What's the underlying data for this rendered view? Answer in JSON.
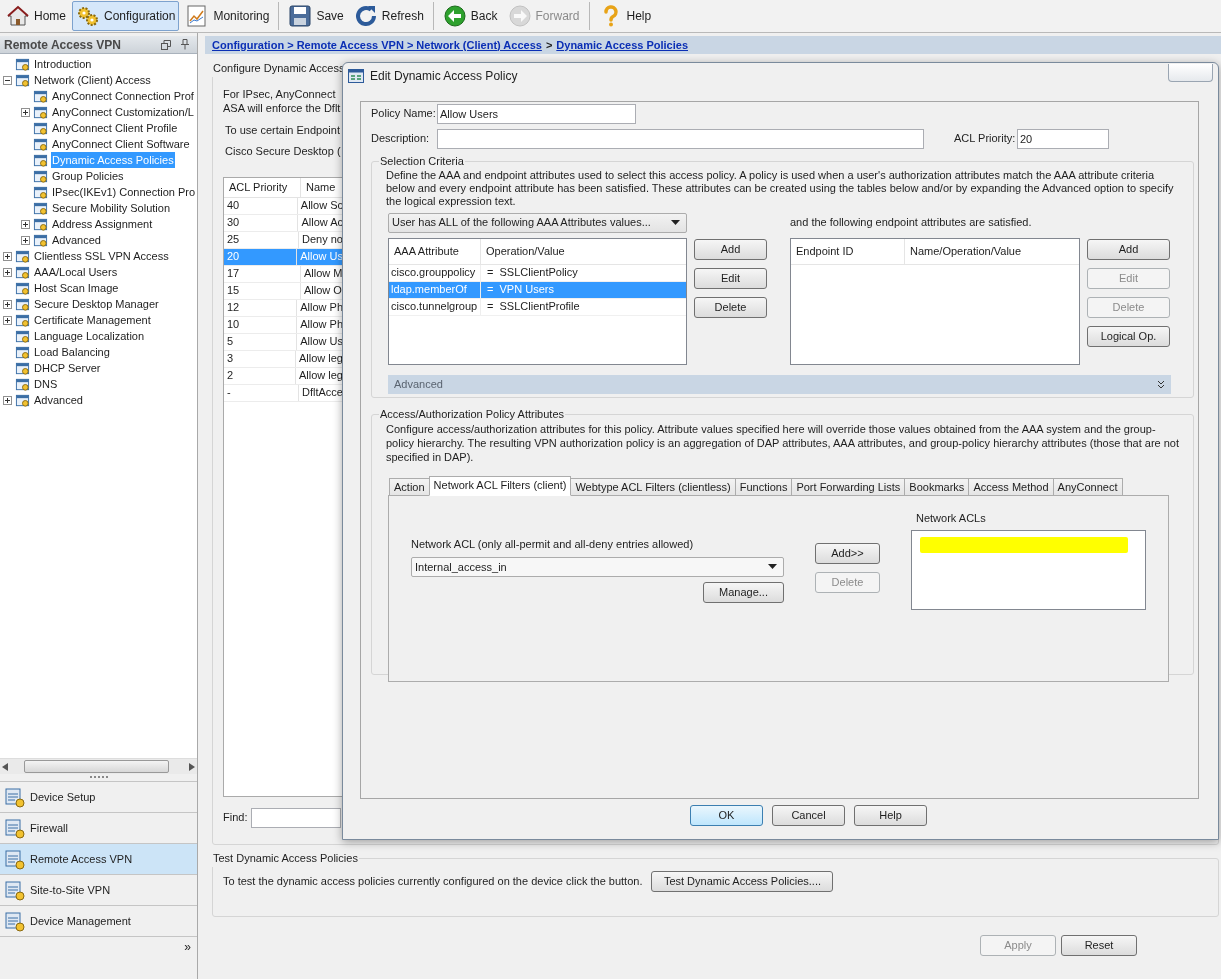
{
  "toolbar": {
    "groups": [
      [
        {
          "label": "Home",
          "selected": false,
          "disabled": false
        },
        {
          "label": "Configuration",
          "selected": true,
          "disabled": false
        },
        {
          "label": "Monitoring",
          "selected": false,
          "disabled": false
        }
      ],
      [
        {
          "label": "Save",
          "selected": false,
          "disabled": false
        },
        {
          "label": "Refresh",
          "selected": false,
          "disabled": false
        }
      ],
      [
        {
          "label": "Back",
          "selected": false,
          "disabled": false
        },
        {
          "label": "Forward",
          "selected": false,
          "disabled": true
        }
      ],
      [
        {
          "label": "Help",
          "selected": false,
          "disabled": false
        }
      ]
    ]
  },
  "sidebar": {
    "title": "Remote Access VPN",
    "tree": [
      {
        "label": "Introduction",
        "selected": false
      },
      {
        "label": "Network (Client) Access",
        "selected": false,
        "expanded": true,
        "children": [
          {
            "label": "AnyConnect Connection Prof",
            "selected": false
          },
          {
            "label": "AnyConnect Customization/L",
            "selected": false,
            "expanded": false
          },
          {
            "label": "AnyConnect Client Profile",
            "selected": false
          },
          {
            "label": "AnyConnect Client Software",
            "selected": false
          },
          {
            "label": "Dynamic Access Policies",
            "selected": true
          },
          {
            "label": "Group Policies",
            "selected": false
          },
          {
            "label": "IPsec(IKEv1) Connection Pro",
            "selected": false
          },
          {
            "label": "Secure Mobility Solution",
            "selected": false
          },
          {
            "label": "Address Assignment",
            "selected": false,
            "expanded": false
          },
          {
            "label": "Advanced",
            "selected": false,
            "expanded": false
          }
        ]
      },
      {
        "label": "Clientless SSL VPN Access",
        "selected": false,
        "expanded": false
      },
      {
        "label": "AAA/Local Users",
        "selected": false,
        "expanded": false
      },
      {
        "label": "Host Scan Image",
        "selected": false
      },
      {
        "label": "Secure Desktop Manager",
        "selected": false,
        "expanded": false
      },
      {
        "label": "Certificate Management",
        "selected": false,
        "expanded": false
      },
      {
        "label": "Language Localization",
        "selected": false
      },
      {
        "label": "Load Balancing",
        "selected": false
      },
      {
        "label": "DHCP Server",
        "selected": false
      },
      {
        "label": "DNS",
        "selected": false
      },
      {
        "label": "Advanced",
        "selected": false,
        "expanded": false
      }
    ],
    "nav": [
      {
        "label": "Device Setup",
        "selected": false
      },
      {
        "label": "Firewall",
        "selected": false
      },
      {
        "label": "Remote Access VPN",
        "selected": true
      },
      {
        "label": "Site-to-Site VPN",
        "selected": false
      },
      {
        "label": "Device Management",
        "selected": false
      }
    ],
    "more": "»"
  },
  "breadcrumb": [
    {
      "text": "Configuration > Remote Access VPN > Network (Client) Access",
      "link": true
    },
    {
      "text": ">",
      "link": false
    },
    {
      "text": "Dynamic Access Policies",
      "link": true
    }
  ],
  "main": {
    "legend": "Configure Dynamic Access",
    "lines": [
      "For IPsec, AnyConnect",
      "ASA will enforce the Dflt",
      "To use certain Endpoint",
      "Cisco Secure Desktop ("
    ],
    "table": {
      "columns": [
        "ACL Priority",
        "Name"
      ],
      "rows": [
        {
          "cells": [
            "40",
            "Allow Sc"
          ],
          "selected": false
        },
        {
          "cells": [
            "30",
            "Allow Ac"
          ],
          "selected": false
        },
        {
          "cells": [
            "25",
            "Deny no"
          ],
          "selected": false
        },
        {
          "cells": [
            "20",
            "Allow Us"
          ],
          "selected": true
        },
        {
          "cells": [
            "17",
            "Allow M"
          ],
          "selected": false
        },
        {
          "cells": [
            "15",
            "Allow O"
          ],
          "selected": false
        },
        {
          "cells": [
            "12",
            "Allow Ph"
          ],
          "selected": false
        },
        {
          "cells": [
            "10",
            "Allow Ph"
          ],
          "selected": false
        },
        {
          "cells": [
            "5",
            "Allow Us"
          ],
          "selected": false
        },
        {
          "cells": [
            "3",
            "Allow leg"
          ],
          "selected": false
        },
        {
          "cells": [
            "2",
            "Allow leg"
          ],
          "selected": false
        },
        {
          "cells": [
            "-",
            "DfltAcce"
          ],
          "selected": false
        }
      ]
    },
    "find_label": "Find:",
    "test_group": {
      "legend": "Test Dynamic Access Policies",
      "text": "To test the dynamic access policies currently configured on the device click the button.",
      "button": "Test Dynamic Access Policies...."
    },
    "buttons": [
      {
        "label": "Apply",
        "disabled": true
      },
      {
        "label": "Reset",
        "disabled": false
      }
    ]
  },
  "dialog": {
    "title": "Edit Dynamic Access Policy",
    "policy_name": {
      "label": "Policy Name:",
      "value": "Allow Users"
    },
    "description": {
      "label": "Description:"
    },
    "acl_priority": {
      "label": "ACL Priority:",
      "value": "20"
    },
    "selection": {
      "legend": "Selection Criteria",
      "text": "Define the AAA and endpoint attributes used to select this access policy. A policy is used when a user's authorization attributes match the AAA attribute criteria below and every endpoint attribute has been satisfied. These attributes can be created using the tables below and/or by expanding the Advanced option to specify the logical expression text.",
      "match_dropdown": "User has ALL of the following AAA Attributes values...",
      "endpoint_text": "and the following endpoint attributes are satisfied.",
      "aaa_table": {
        "columns": [
          "AAA Attribute",
          "Operation/Value"
        ],
        "rows": [
          {
            "cells": [
              "cisco.grouppolicy",
              "=  SSLClientPolicy"
            ],
            "selected": false
          },
          {
            "cells": [
              "ldap.memberOf",
              "=  VPN Users"
            ],
            "selected": true
          },
          {
            "cells": [
              "cisco.tunnelgroup",
              "=  SSLClientProfile"
            ],
            "selected": false
          }
        ]
      },
      "aaa_buttons": [
        {
          "label": "Add",
          "disabled": false
        },
        {
          "label": "Edit",
          "disabled": false
        },
        {
          "label": "Delete",
          "disabled": false
        }
      ],
      "endpoint_table": {
        "columns": [
          "Endpoint ID",
          "Name/Operation/Value"
        ]
      },
      "endpoint_buttons": [
        {
          "label": "Add",
          "disabled": false
        },
        {
          "label": "Edit",
          "disabled": true
        },
        {
          "label": "Delete",
          "disabled": true
        },
        {
          "label": "Logical Op.",
          "disabled": false
        }
      ],
      "advanced": {
        "label": "Advanced",
        "expanded": false
      }
    },
    "attributes": {
      "legend": "Access/Authorization Policy Attributes",
      "text": "Configure access/authorization attributes for this policy. Attribute values specified here will override those values obtained from the AAA system and the group-policy hierarchy. The resulting VPN authorization policy is an aggregation of DAP attributes, AAA attributes, and group-policy hierarchy attributes (those that are not specified in DAP).",
      "tabs": [
        {
          "label": "Action",
          "selected": false
        },
        {
          "label": "Network ACL Filters (client)",
          "selected": true
        },
        {
          "label": "Webtype ACL Filters (clientless)",
          "selected": false
        },
        {
          "label": "Functions",
          "selected": false
        },
        {
          "label": "Port Forwarding Lists",
          "selected": false
        },
        {
          "label": "Bookmarks",
          "selected": false
        },
        {
          "label": "Access Method",
          "selected": false
        },
        {
          "label": "AnyConnect",
          "selected": false
        }
      ],
      "acl_label": "Network ACL (only all-permit and all-deny entries allowed)",
      "acl_dropdown": "Internal_access_in",
      "manage_button": "Manage...",
      "move_buttons": [
        {
          "label": "Add>>",
          "disabled": false
        },
        {
          "label": "Delete",
          "disabled": true
        }
      ],
      "acl_list": {
        "label": "Network ACLs",
        "redacted": true
      }
    },
    "buttons": [
      {
        "label": "OK",
        "default": true
      },
      {
        "label": "Cancel",
        "default": false
      },
      {
        "label": "Help",
        "default": false
      }
    ]
  }
}
